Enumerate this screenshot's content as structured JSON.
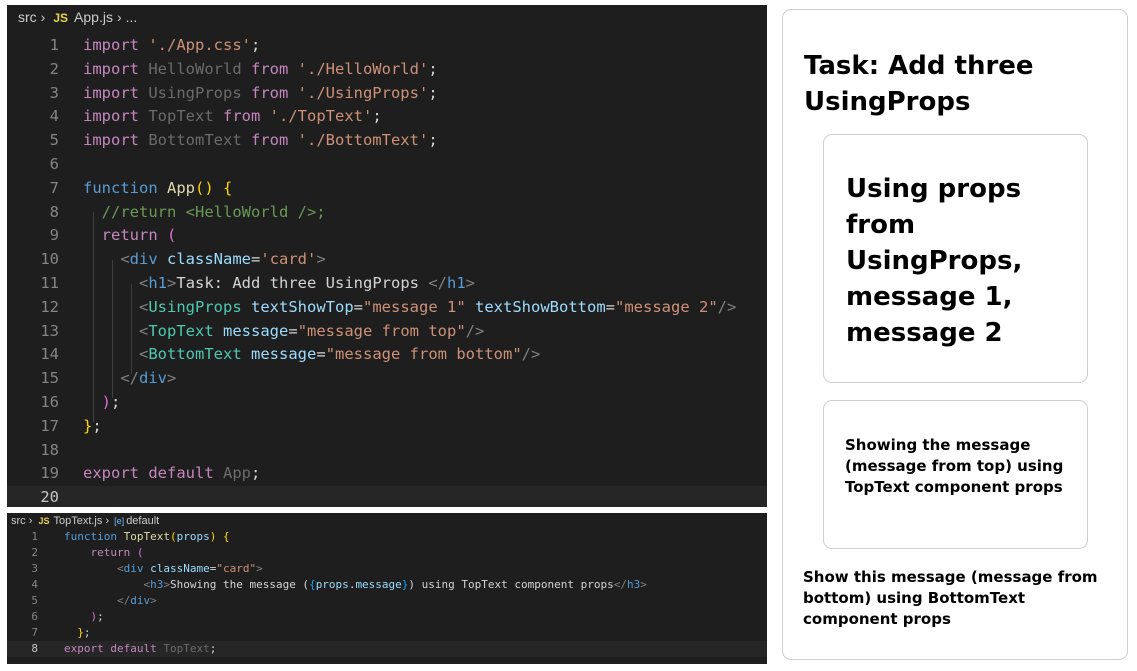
{
  "editor1": {
    "breadcrumb": {
      "folder": "src",
      "js_badge": "JS",
      "file": "App.js",
      "more": "..."
    },
    "lines": [
      {
        "n": "1",
        "tokens": [
          [
            "kw",
            "import"
          ],
          [
            "tx",
            " "
          ],
          [
            "str",
            "'./App.css'"
          ],
          [
            "tx",
            ";"
          ]
        ]
      },
      {
        "n": "2",
        "tokens": [
          [
            "kw",
            "import"
          ],
          [
            "dim",
            " HelloWorld "
          ],
          [
            "kw",
            "from"
          ],
          [
            "tx",
            " "
          ],
          [
            "str",
            "'./HelloWorld'"
          ],
          [
            "tx",
            ";"
          ]
        ]
      },
      {
        "n": "3",
        "tokens": [
          [
            "kw",
            "import"
          ],
          [
            "dim",
            " UsingProps "
          ],
          [
            "kw",
            "from"
          ],
          [
            "tx",
            " "
          ],
          [
            "str",
            "'./UsingProps'"
          ],
          [
            "tx",
            ";"
          ]
        ]
      },
      {
        "n": "4",
        "tokens": [
          [
            "kw",
            "import"
          ],
          [
            "dim",
            " TopText "
          ],
          [
            "kw",
            "from"
          ],
          [
            "tx",
            " "
          ],
          [
            "str",
            "'./TopText'"
          ],
          [
            "tx",
            ";"
          ]
        ]
      },
      {
        "n": "5",
        "tokens": [
          [
            "kw",
            "import"
          ],
          [
            "dim",
            " BottomText "
          ],
          [
            "kw",
            "from"
          ],
          [
            "tx",
            " "
          ],
          [
            "str",
            "'./BottomText'"
          ],
          [
            "tx",
            ";"
          ]
        ]
      },
      {
        "n": "6",
        "tokens": []
      },
      {
        "n": "7",
        "tokens": [
          [
            "kw2",
            "function"
          ],
          [
            "tx",
            " "
          ],
          [
            "fn",
            "App"
          ],
          [
            "br1",
            "()"
          ],
          [
            "tx",
            " "
          ],
          [
            "br1",
            "{"
          ]
        ]
      },
      {
        "n": "8",
        "tokens": [
          [
            "tx",
            "  "
          ],
          [
            "cm",
            "//return <HelloWorld />;"
          ]
        ]
      },
      {
        "n": "9",
        "tokens": [
          [
            "tx",
            "  "
          ],
          [
            "kw",
            "return"
          ],
          [
            "tx",
            " "
          ],
          [
            "br2",
            "("
          ]
        ]
      },
      {
        "n": "10",
        "tokens": [
          [
            "tx",
            "    "
          ],
          [
            "tag",
            "<"
          ],
          [
            "tn",
            "div"
          ],
          [
            "tx",
            " "
          ],
          [
            "at",
            "className"
          ],
          [
            "tx",
            "="
          ],
          [
            "str",
            "'card'"
          ],
          [
            "tag",
            ">"
          ]
        ]
      },
      {
        "n": "11",
        "tokens": [
          [
            "tx",
            "      "
          ],
          [
            "tag",
            "<"
          ],
          [
            "tn",
            "h1"
          ],
          [
            "tag",
            ">"
          ],
          [
            "tx",
            "Task: Add three UsingProps "
          ],
          [
            "tag",
            "</"
          ],
          [
            "tn",
            "h1"
          ],
          [
            "tag",
            ">"
          ]
        ]
      },
      {
        "n": "12",
        "tokens": [
          [
            "tx",
            "      "
          ],
          [
            "tag",
            "<"
          ],
          [
            "cmp",
            "UsingProps"
          ],
          [
            "tx",
            " "
          ],
          [
            "at",
            "textShowTop"
          ],
          [
            "tx",
            "="
          ],
          [
            "str",
            "\"message 1\""
          ],
          [
            "tx",
            " "
          ],
          [
            "at",
            "textShowBottom"
          ],
          [
            "tx",
            "="
          ],
          [
            "str",
            "\"message 2\""
          ],
          [
            "tag",
            "/>"
          ]
        ]
      },
      {
        "n": "13",
        "tokens": [
          [
            "tx",
            "      "
          ],
          [
            "tag",
            "<"
          ],
          [
            "cmp",
            "TopText"
          ],
          [
            "tx",
            " "
          ],
          [
            "at",
            "message"
          ],
          [
            "tx",
            "="
          ],
          [
            "str",
            "\"message from top\""
          ],
          [
            "tag",
            "/>"
          ]
        ]
      },
      {
        "n": "14",
        "tokens": [
          [
            "tx",
            "      "
          ],
          [
            "tag",
            "<"
          ],
          [
            "cmp",
            "BottomText"
          ],
          [
            "tx",
            " "
          ],
          [
            "at",
            "message"
          ],
          [
            "tx",
            "="
          ],
          [
            "str",
            "\"message from bottom\""
          ],
          [
            "tag",
            "/>"
          ]
        ]
      },
      {
        "n": "15",
        "tokens": [
          [
            "tx",
            "    "
          ],
          [
            "tag",
            "</"
          ],
          [
            "tn",
            "div"
          ],
          [
            "tag",
            ">"
          ]
        ]
      },
      {
        "n": "16",
        "tokens": [
          [
            "tx",
            "  "
          ],
          [
            "br2",
            ")"
          ],
          [
            "tx",
            ";"
          ]
        ]
      },
      {
        "n": "17",
        "tokens": [
          [
            "br1",
            "}"
          ],
          [
            "tx",
            ";"
          ]
        ]
      },
      {
        "n": "18",
        "tokens": []
      },
      {
        "n": "19",
        "tokens": [
          [
            "kw",
            "export"
          ],
          [
            "tx",
            " "
          ],
          [
            "kw",
            "default"
          ],
          [
            "tx",
            " "
          ],
          [
            "dim",
            "App"
          ],
          [
            "tx",
            ";"
          ]
        ]
      },
      {
        "n": "20",
        "tokens": [],
        "current": true
      }
    ]
  },
  "editor2": {
    "breadcrumb": {
      "folder": "src",
      "js_badge": "JS",
      "file": "TopText.js",
      "symbol_icon": "[e]",
      "symbol": "default"
    },
    "lines": [
      {
        "n": "1",
        "tokens": [
          [
            "kw2",
            "function"
          ],
          [
            "tx",
            " "
          ],
          [
            "fn",
            "TopText"
          ],
          [
            "br1",
            "("
          ],
          [
            "var",
            "props"
          ],
          [
            "br1",
            ")"
          ],
          [
            "tx",
            " "
          ],
          [
            "br1",
            "{"
          ]
        ]
      },
      {
        "n": "2",
        "tokens": [
          [
            "tx",
            "    "
          ],
          [
            "kw",
            "return"
          ],
          [
            "tx",
            " "
          ],
          [
            "br2",
            "("
          ]
        ]
      },
      {
        "n": "3",
        "tokens": [
          [
            "tx",
            "        "
          ],
          [
            "tag",
            "<"
          ],
          [
            "tn",
            "div"
          ],
          [
            "tx",
            " "
          ],
          [
            "at",
            "className"
          ],
          [
            "tx",
            "="
          ],
          [
            "str",
            "\"card\""
          ],
          [
            "tag",
            ">"
          ]
        ]
      },
      {
        "n": "4",
        "tokens": [
          [
            "tx",
            "            "
          ],
          [
            "tag",
            "<"
          ],
          [
            "tn",
            "h3"
          ],
          [
            "tag",
            ">"
          ],
          [
            "tx",
            "Showing the message ("
          ],
          [
            "br3",
            "{"
          ],
          [
            "var",
            "props"
          ],
          [
            "tx",
            "."
          ],
          [
            "var",
            "message"
          ],
          [
            "br3",
            "}"
          ],
          [
            "tx",
            ") using TopText component props"
          ],
          [
            "tag",
            "</"
          ],
          [
            "tn",
            "h3"
          ],
          [
            "tag",
            ">"
          ]
        ]
      },
      {
        "n": "5",
        "tokens": [
          [
            "tx",
            "        "
          ],
          [
            "tag",
            "</"
          ],
          [
            "tn",
            "div"
          ],
          [
            "tag",
            ">"
          ]
        ]
      },
      {
        "n": "6",
        "tokens": [
          [
            "tx",
            "    "
          ],
          [
            "br2",
            ")"
          ],
          [
            "tx",
            ";"
          ]
        ]
      },
      {
        "n": "7",
        "tokens": [
          [
            "tx",
            "  "
          ],
          [
            "br1",
            "}"
          ],
          [
            "tx",
            ";"
          ]
        ]
      },
      {
        "n": "8",
        "tokens": [
          [
            "kw",
            "export"
          ],
          [
            "tx",
            " "
          ],
          [
            "kw",
            "default"
          ],
          [
            "tx",
            " "
          ],
          [
            "dim",
            "TopText"
          ],
          [
            "tx",
            ";"
          ]
        ],
        "current": true
      }
    ]
  },
  "preview": {
    "title": "Task: Add three UsingProps",
    "using_props_text": "Using props from UsingProps, message 1, message 2",
    "top_text": "Showing the message (message from top) using TopText component props",
    "bottom_text": "Show this message (message from bottom) using BottomText component props"
  },
  "colors": {
    "editor_bg": "#1e1e1e",
    "keyword_purple": "#c586c0",
    "keyword_blue": "#569cd6",
    "string": "#ce9178",
    "function": "#dcdcaa",
    "component": "#4ec9b0",
    "attribute": "#9cdcfe",
    "comment": "#6a9955"
  }
}
